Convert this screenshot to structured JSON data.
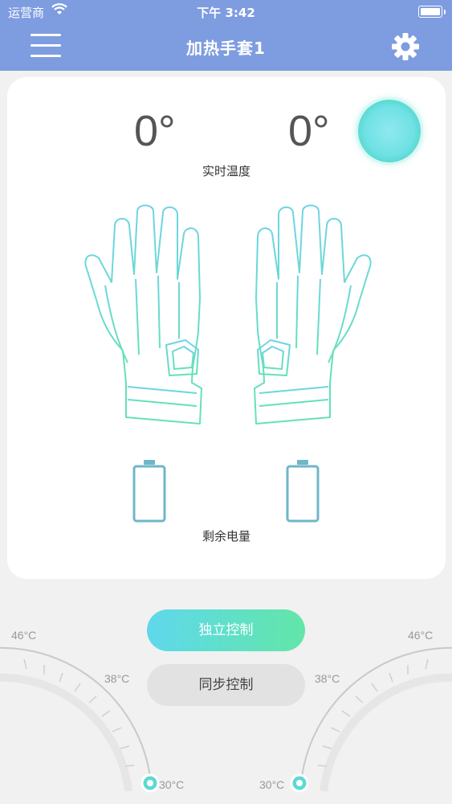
{
  "status_bar": {
    "carrier": "运营商",
    "time": "下午 3:42"
  },
  "nav": {
    "title": "加热手套1",
    "menu_icon": "menu-icon",
    "settings_icon": "gear-icon"
  },
  "card": {
    "left_temp": "0°",
    "right_temp": "0°",
    "temp_label": "实时温度",
    "battery_label": "剩余电量",
    "power_icon": "power-button"
  },
  "controls": {
    "independent_label": "独立控制",
    "sync_label": "同步控制"
  },
  "dial_left": {
    "max_label": "46°C",
    "mid_label": "38°C",
    "min_label": "30°C"
  },
  "dial_right": {
    "max_label": "46°C",
    "mid_label": "38°C",
    "min_label": "30°C"
  },
  "colors": {
    "nav_background": "#7e9ce0",
    "accent_cyan": "#5fd8ec",
    "accent_green": "#62e6a8",
    "battery_outline": "#6fb6c9"
  }
}
